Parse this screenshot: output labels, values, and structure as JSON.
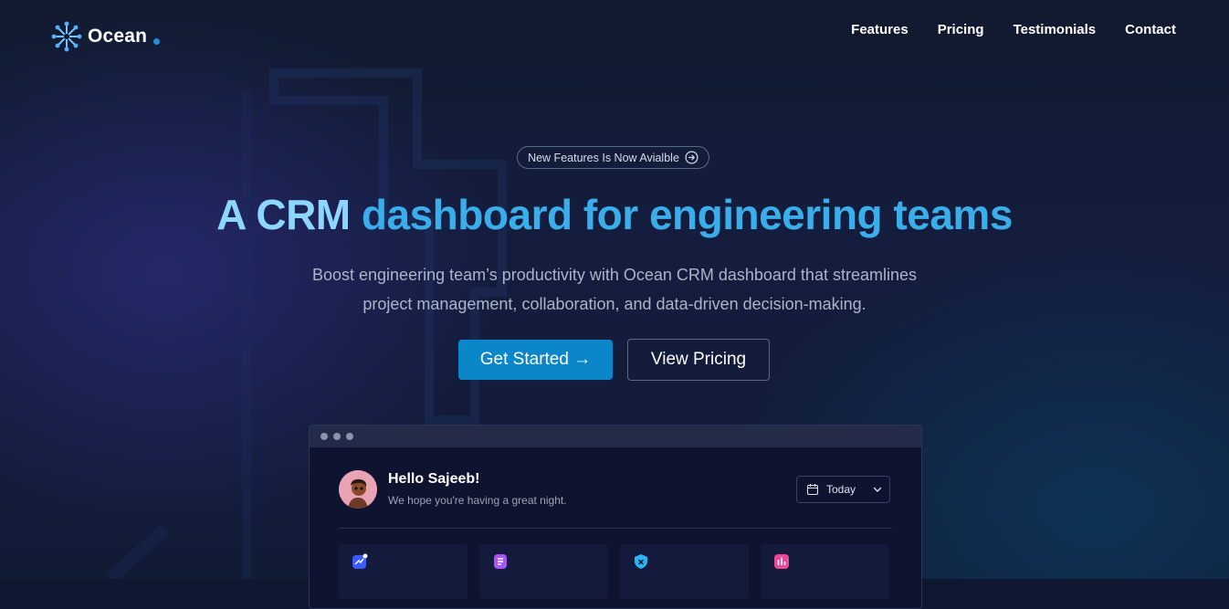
{
  "brand": {
    "name": "Ocean",
    "accent": "#1f8fe0"
  },
  "nav": {
    "links": [
      "Features",
      "Pricing",
      "Testimonials",
      "Contact"
    ]
  },
  "hero": {
    "badge_text": "New Features Is Now Avialble",
    "badge_icon": "arrow-circle-right-icon",
    "title_part1": "A CRM",
    "title_part2": "dashboard for engineering teams",
    "subtitle_line1": "Boost engineering team’s productivity with Ocean CRM dashboard that streamlines",
    "subtitle_line2": "project management, collaboration, and data-driven decision-making.",
    "primary_button": "Get Started →",
    "secondary_button": "View Pricing"
  },
  "dashboard": {
    "greeting": "Hello Sajeeb!",
    "subgreeting": "We hope you're having a great night.",
    "date_filter": "Today",
    "cards": [
      {
        "icon": "chart-growth-icon",
        "color": "#3b5bff"
      },
      {
        "icon": "document-icon",
        "color": "#a855f7"
      },
      {
        "icon": "shield-icon",
        "color": "#29b6f6"
      },
      {
        "icon": "bar-chart-icon",
        "color": "#ec4899"
      }
    ]
  },
  "colors": {
    "background": "#0f1830",
    "title_light": "#8dd6ff",
    "title_blue": "#3aaeea",
    "primary_button": "#0b86c9"
  }
}
